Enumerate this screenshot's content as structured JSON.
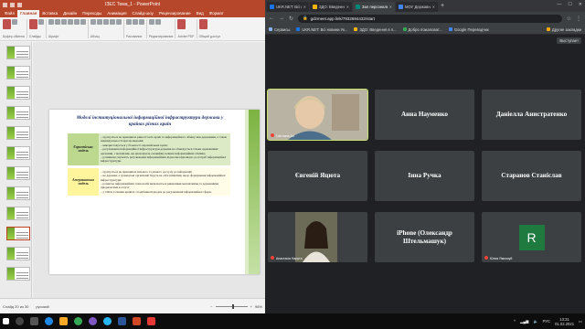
{
  "powerpoint": {
    "title": "ІЗЕС Тема_1 - PowerPoint",
    "tabs": [
      "Файл",
      "Главная",
      "Вставка",
      "Дизайн",
      "Переходы",
      "Анимация",
      "Слайд-шоу",
      "Рецензирование",
      "Вид",
      "Формат"
    ],
    "ribbon_groups": [
      "Буфер обмена",
      "Слайды",
      "Шрифт",
      "Абзац",
      "Рисование",
      "Редактирование",
      "Adobe PDF",
      "Общий доступ"
    ],
    "status_left": "Слайд 20 из 30",
    "status_lang": "русский",
    "zoom": "96%",
    "slide": {
      "title": "Моделі інституціональної інформаційної інфраструктури держави у країнах різних країн",
      "rows": [
        {
          "label": "Європейська модель",
          "items": [
            "– ґрунтується на принципах рівності всіх країн та інформаційного обміну між державами, а також індивідуальності при проведенні;",
            "– використовується у більшості європейських країн;",
            "– регулювання інформаційної інфраструктури держави не обмежується тільки державними органами, є механізми, що враховують специфіку певних інформаційних обмінів;",
            "– розвинена гнучкість регулювання інформаційних відносин відповідно до потреб інформаційної інфраструктури."
          ]
        },
        {
          "label": "Американська модель",
          "items": [
            "– ґрунтується на принципах вільного та рівного доступу до інформації;",
            "– не держава, а громадські організації беруть на себе ініціативу щодо формування інформаційної інфраструктури;",
            "– розвиток інформаційних технологій визначається ринковими механізмами та державними пріоритетами в галузі;",
            "– у США та інших країнах з подібним підходом до регулювання інформаційної сфери."
          ]
        }
      ]
    }
  },
  "chrome": {
    "tabs": [
      {
        "title": "UKR.NET: Всі новини Укр",
        "color": "#1a73e8"
      },
      {
        "title": "ЗДО: Введення в п...",
        "color": "#f4b400"
      },
      {
        "title": "Зал персональної ...",
        "color": "#00897b"
      },
      {
        "title": "МОУ Державна та мела",
        "color": "#4285f4"
      }
    ],
    "url": "gdzmeet.app.link/7932694432/start",
    "bookmarks": [
      {
        "label": "Сервисы",
        "color": "#8ab4f8"
      },
      {
        "label": "UKR.NET: Всі новини Ук...",
        "color": "#1a73e8"
      },
      {
        "label": "ЗДО: Введення в п...",
        "color": "#f4b400"
      },
      {
        "label": "Добро пожаловат...",
        "color": "#34a853"
      },
      {
        "label": "Google Переводчик",
        "color": "#4285f4"
      }
    ],
    "bookmarks_right": "Другие закладки",
    "meet_top": "Выступает",
    "participants": [
      {
        "name": "Світлана Ал",
        "type": "video-woman"
      },
      {
        "name": "Анна Науменко"
      },
      {
        "name": "Даніелла Анистратенко"
      },
      {
        "name": "Євгеній Яцюта"
      },
      {
        "name": "Інна Ручка"
      },
      {
        "name": "Старанов Станіслав"
      },
      {
        "name": "Анастасія Нарута",
        "type": "video-girl"
      },
      {
        "name": "iPhone (Олександр Штельмашук)"
      },
      {
        "name": "Юлия Ямолкуй",
        "type": "avatar",
        "initial": "R"
      }
    ]
  },
  "taskbar": {
    "time": "13:31",
    "date": "01.02.2021",
    "lang": "РУС"
  }
}
